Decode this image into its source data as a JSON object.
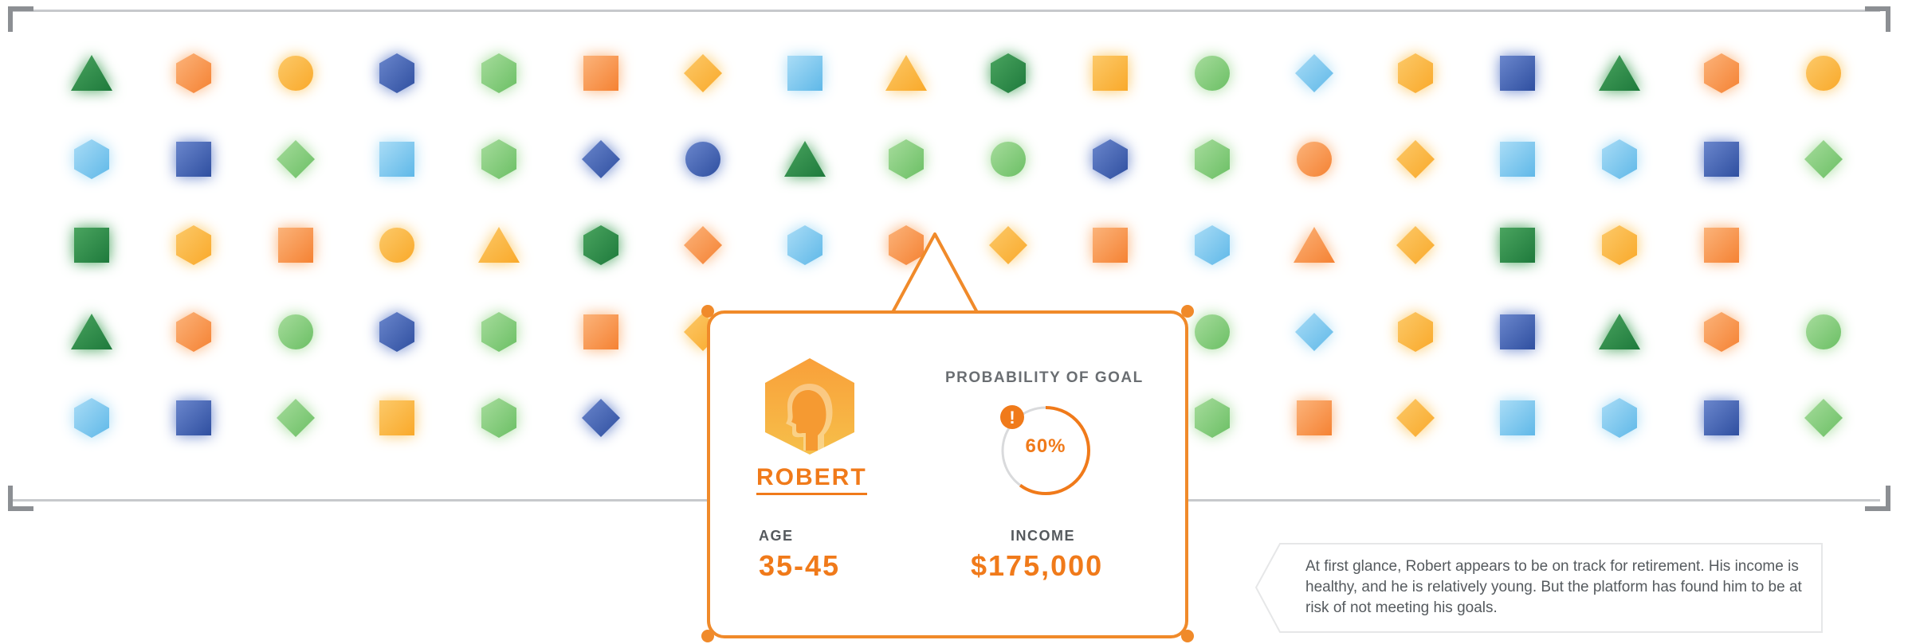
{
  "colors": {
    "orange": "#f58233",
    "yellow_orange": "#f9a92a",
    "green": "#6bbf64",
    "dark_green": "#1e7a3c",
    "light_blue": "#5fb8e8",
    "navy_blue": "#2f4fa0",
    "accent": "#f07a1a",
    "frame": "#c7c9cc"
  },
  "shape_grid": {
    "rows": [
      [
        "triangle-dkgreen",
        "hexagon-orange",
        "circle-yellow",
        "hexagon-navy",
        "hexagon-green",
        "square-orange",
        "diamond-yellow",
        "square-lblue",
        "triangle-yellow",
        "hexagon-dkgreen",
        "square-yellow",
        "circle-green",
        "diamond-lblue",
        "hexagon-yellow",
        "square-navy",
        "triangle-dkgreen",
        "hexagon-orange",
        "circle-yellow"
      ],
      [
        "hexagon-lblue",
        "square-navy",
        "diamond-green",
        "square-lblue",
        "hexagon-green",
        "diamond-navy",
        "circle-navy",
        "triangle-dkgreen",
        "hexagon-green",
        "circle-green",
        "hexagon-navy",
        "hexagon-green",
        "circle-orange",
        "diamond-yellow",
        "square-lblue",
        "hexagon-lblue",
        "square-navy",
        "diamond-green"
      ],
      [
        "square-dkgreen",
        "hexagon-yellow",
        "square-orange",
        "circle-yellow",
        "triangle-yellow",
        "hexagon-dkgreen",
        "diamond-orange",
        "hexagon-lblue",
        "hexagon-orange",
        "diamond-yellow",
        "square-orange",
        "hexagon-lblue",
        "triangle-orange",
        "diamond-yellow",
        "square-dkgreen",
        "hexagon-yellow",
        "square-orange"
      ],
      [
        "triangle-dkgreen",
        "hexagon-orange",
        "circle-green",
        "hexagon-navy",
        "hexagon-green",
        "square-orange",
        "diamond-yellow",
        "",
        "",
        "",
        "",
        "circle-green",
        "diamond-lblue",
        "hexagon-yellow",
        "square-navy",
        "triangle-dkgreen",
        "hexagon-orange",
        "circle-green"
      ],
      [
        "hexagon-lblue",
        "square-navy",
        "diamond-green",
        "square-yellow",
        "hexagon-green",
        "diamond-navy",
        "",
        "",
        "",
        "",
        "",
        "hexagon-green",
        "square-orange",
        "diamond-yellow",
        "square-lblue",
        "hexagon-lblue",
        "square-navy",
        "diamond-green"
      ]
    ]
  },
  "profile_card": {
    "avatar_icon": "person-head-hexagon-icon",
    "name": "ROBERT",
    "probability_label": "PROBABILITY OF GOAL",
    "probability_value": "60%",
    "probability_fraction": 0.6,
    "warning_icon": "exclamation-icon",
    "warning_symbol": "!",
    "age_label": "AGE",
    "age_value": "35-45",
    "income_label": "INCOME",
    "income_value": "$175,000"
  },
  "note": {
    "text": "At first glance, Robert appears to be on track for retirement. His income is healthy, and he is relatively young. But the platform has found him to be at risk of not meeting his goals."
  }
}
